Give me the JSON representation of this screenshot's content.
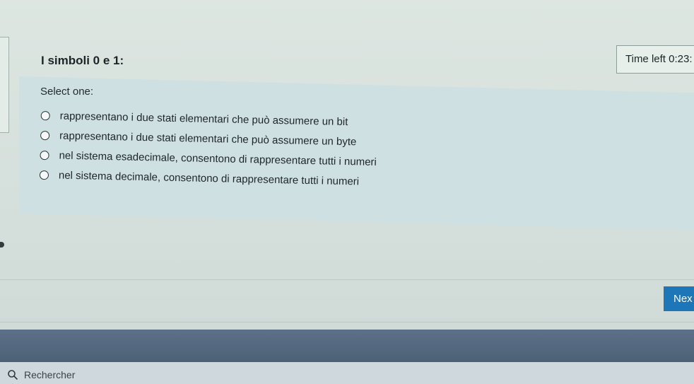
{
  "question": {
    "title": "I simboli 0 e 1:",
    "prompt": "Select one:",
    "options": [
      "rappresentano i due stati elementari che può assumere un bit",
      "rappresentano i due stati elementari che può assumere un byte",
      "nel sistema esadecimale, consentono di rappresentare tutti i numeri",
      "nel sistema decimale, consentono di rappresentare tutti i numeri"
    ]
  },
  "timer": {
    "text": "Time left 0:23:"
  },
  "navigation": {
    "next_label": "Nex"
  },
  "taskbar": {
    "search_placeholder": "Rechercher"
  },
  "colors": {
    "accent": "#1d76b7",
    "panel": "#cfe0e3",
    "taskbar": "#51667b"
  }
}
